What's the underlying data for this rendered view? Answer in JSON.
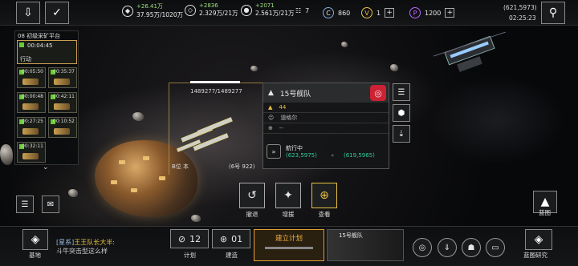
{
  "resources": [
    {
      "gain": "+26.41万",
      "amount": "37.95万/1020万",
      "icon": "ore-icon"
    },
    {
      "gain": "+2836",
      "amount": "2.329万/21万",
      "icon": "crystal-icon"
    },
    {
      "gain": "+2071",
      "amount": "2.561万/21万",
      "icon": "gas-icon"
    }
  ],
  "counters": {
    "ships": "7",
    "credits": "860",
    "tokens": "1",
    "gems": "1200"
  },
  "coords": "(621,5973)",
  "clock": "02:25:23",
  "queue": {
    "title": "08 初级采矿平台",
    "main_timer": "00:04:45",
    "status": "行动",
    "tiles": [
      "00:05:50",
      "00:35:37",
      "00:00:48",
      "00:42:11",
      "00:27:25",
      "00:10:52",
      "00:32:11"
    ]
  },
  "fleet": {
    "hp": "1489277/1489277",
    "label_a": "B位 本",
    "label_b": "(6号 922)"
  },
  "panel": {
    "title": "15号舰队",
    "level": "44",
    "captain": "道格尔",
    "cargo": "--",
    "state": "航行中",
    "from": "(623,5975)",
    "to": "(619,5965)"
  },
  "actions": [
    {
      "label": "撤退",
      "icon": "retreat-icon"
    },
    {
      "label": "增援",
      "icon": "reinforce-icon"
    },
    {
      "label": "查看",
      "icon": "view-icon"
    }
  ],
  "blueprint": "蓝图",
  "bottom": {
    "base": "基地",
    "chat_channel": "[星系]",
    "chat_user": "王王队长大半:",
    "chat_msg": "斗牛突击型这么样",
    "plan_count": "12",
    "plan_label": "计划",
    "build_count": "01",
    "build_label": "建造",
    "build_plan": "建立计划",
    "fleet_tag": "15号舰队",
    "research": "蓝图研究"
  }
}
